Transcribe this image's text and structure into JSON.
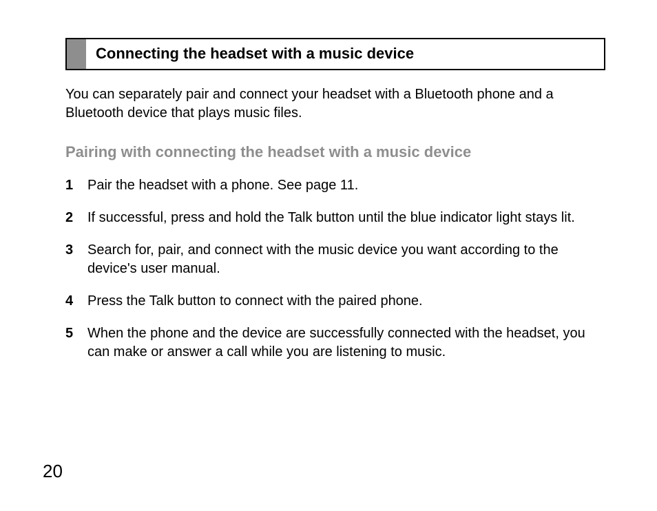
{
  "header": {
    "title": "Connecting the headset with a music device"
  },
  "intro": "You can separately pair and connect your headset with a Bluetooth phone and a Bluetooth device that plays music files.",
  "subtitle": "Pairing with connecting the headset with a music device",
  "steps": [
    {
      "num": "1",
      "text": "Pair the headset with a phone. See page 11."
    },
    {
      "num": "2",
      "text": "If successful, press and hold the Talk button until the blue indicator light stays lit."
    },
    {
      "num": "3",
      "text": "Search for, pair, and connect with the music device you want according to the device's user manual."
    },
    {
      "num": "4",
      "text": "Press the Talk button to connect with the paired phone."
    },
    {
      "num": "5",
      "text": "When the phone and the device are successfully connected with the headset, you can make or answer a call while you are listening to music."
    }
  ],
  "pageNumber": "20"
}
